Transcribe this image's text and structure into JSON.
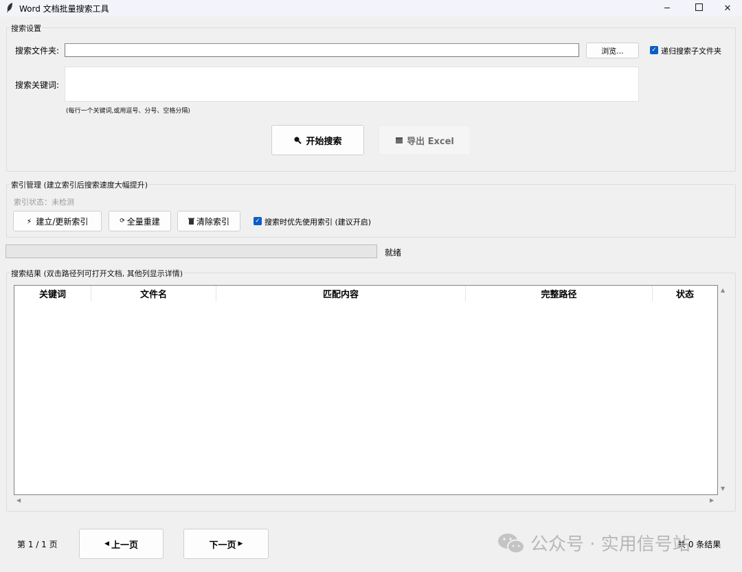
{
  "window": {
    "title": "Word 文档批量搜索工具",
    "minimize_glyph": "─",
    "maximize_glyph": "☐",
    "close_glyph": "✕"
  },
  "search_settings": {
    "group_label": "搜索设置",
    "folder_label": "搜索文件夹:",
    "folder_value": "",
    "browse_label": "浏览...",
    "recursive_label": "递归搜索子文件夹",
    "recursive_checked": true,
    "keywords_label": "搜索关键词:",
    "keywords_value": "",
    "keywords_hint": "(每行一个关键词,或用逗号、分号、空格分隔)",
    "start_label": "开始搜索",
    "export_label": "导出 Excel"
  },
  "index": {
    "group_label": "索引管理 (建立索引后搜索速度大幅提升)",
    "status_text": "索引状态：未检测",
    "build_label": "建立/更新索引",
    "rebuild_label": "全量重建",
    "clear_label": "清除索引",
    "use_index_label": "搜索时优先使用索引 (建议开启)",
    "use_index_checked": true
  },
  "progress": {
    "value": 0,
    "status_text": "就绪"
  },
  "results": {
    "group_label": "搜索结果 (双击路径列可打开文档, 其他列显示详情)",
    "columns": [
      "关键词",
      "文件名",
      "匹配内容",
      "完整路径",
      "状态"
    ],
    "rows": []
  },
  "pager": {
    "page_text": "第 1 / 1 页",
    "prev_label": "上一页",
    "next_label": "下一页",
    "total_text": "共 0 条结果"
  },
  "watermark": {
    "text": "公众号 · 实用信号站"
  },
  "colors": {
    "accent": "#0a5ec6",
    "progress": "#06b025",
    "background": "#f0f0f0"
  }
}
